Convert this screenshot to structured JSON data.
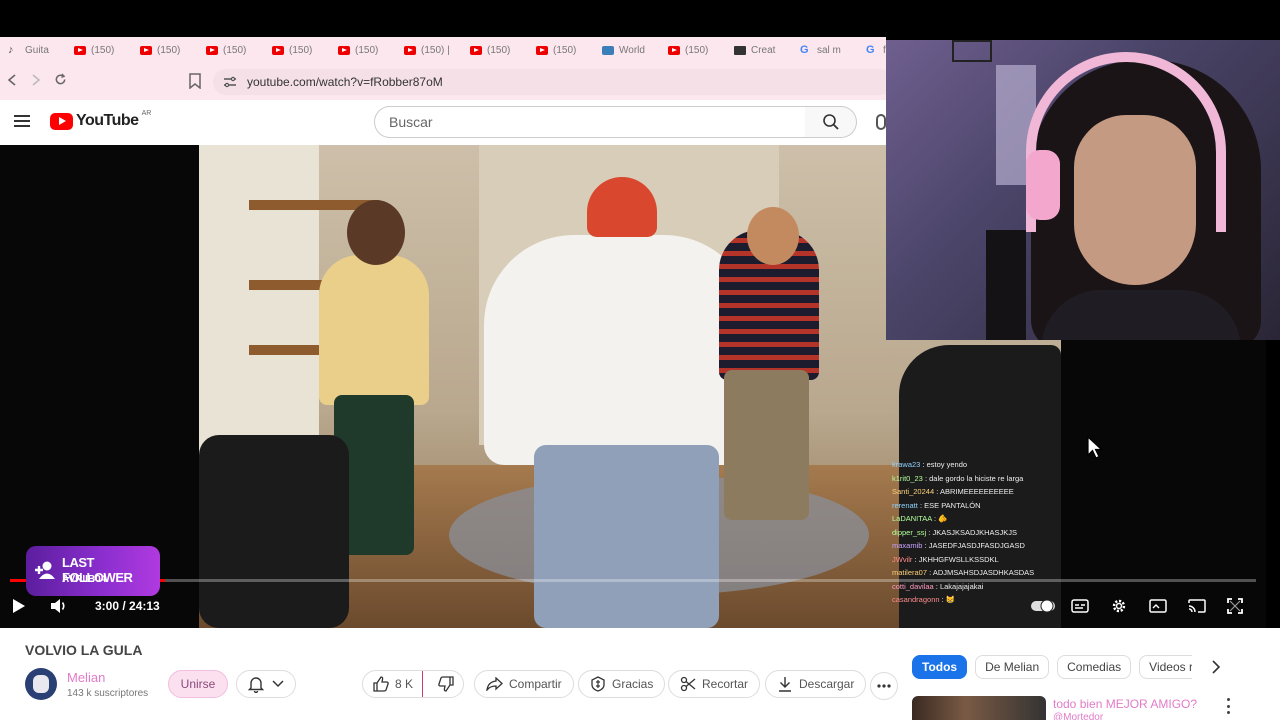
{
  "browser": {
    "tabs": [
      {
        "icon": "guitar-icon",
        "label": "Guita"
      },
      {
        "icon": "youtube-icon",
        "label": "(150)"
      },
      {
        "icon": "youtube-icon",
        "label": "(150)"
      },
      {
        "icon": "youtube-icon",
        "label": "(150)"
      },
      {
        "icon": "youtube-icon",
        "label": "(150)"
      },
      {
        "icon": "youtube-icon",
        "label": "(150)"
      },
      {
        "icon": "youtube-icon",
        "label": "(150) |"
      },
      {
        "icon": "youtube-icon",
        "label": "(150)"
      },
      {
        "icon": "youtube-icon",
        "label": "(150)"
      },
      {
        "icon": "world-icon",
        "label": "World"
      },
      {
        "icon": "youtube-icon",
        "label": "(150)"
      },
      {
        "icon": "creator-icon",
        "label": "Creat"
      },
      {
        "icon": "google-icon",
        "label": "sal m"
      },
      {
        "icon": "google-icon",
        "label": "fo"
      }
    ],
    "url": "youtube.com/watch?v=fRobber87oM"
  },
  "youtube": {
    "logo_text": "YouTube",
    "country_code": "AR",
    "search_placeholder": "Buscar"
  },
  "player": {
    "time": "3:00 / 24:13",
    "progress_fraction": 0.124,
    "chat": [
      {
        "user": "krawa23",
        "msg": "estoy yendo",
        "color": "u1"
      },
      {
        "user": "k1rit0_23",
        "msg": "dale gordo la hiciste re larga",
        "color": "u3"
      },
      {
        "user": "Santi_20244",
        "msg": "ABRIMEEEEEEEEEE",
        "color": "u4"
      },
      {
        "user": "rerenatt",
        "msg": "ESE PANTALÓN",
        "color": "u1"
      },
      {
        "user": "LaDANITAA",
        "msg": "🫵",
        "color": "u3"
      },
      {
        "user": "dipper_ssj",
        "msg": "JKASJKSADJKHASJKJS",
        "color": "u3"
      },
      {
        "user": "maxamib",
        "msg": "JASEDFJASDJFASDJGASD",
        "color": "u5"
      },
      {
        "user": "JWvilr",
        "msg": "JKHHGFWSLLKSSDKL",
        "color": "u6"
      },
      {
        "user": "matilera07",
        "msg": "ADJMSAHSDJASDHKASDAS",
        "color": "u4"
      },
      {
        "user": "cotti_davilaa",
        "msg": "Lakajajajakai",
        "color": "u2"
      },
      {
        "user": "casandragonn",
        "msg": "😸",
        "color": "u6"
      }
    ]
  },
  "overlay": {
    "title": "LAST FOLLOWER",
    "name": "AVRIIB04"
  },
  "video": {
    "title": "VOLVIO LA GULA",
    "channel": "Melian",
    "subscribers": "143 k suscriptores",
    "join_label": "Unirse",
    "likes": "8 K",
    "share_label": "Compartir",
    "thanks_label": "Gracias",
    "clip_label": "Recortar",
    "download_label": "Descargar"
  },
  "sidebar": {
    "chips": [
      "Todos",
      "De Melian",
      "Comedias",
      "Videos relac"
    ],
    "rec_title": "todo bien MEJOR AMIGO?",
    "rec_channel": "@Mortedor"
  },
  "colors": {
    "accent_pink": "#e27bc9",
    "chip_active": "#1a73e8",
    "progress": "#ff0000",
    "follower_bg": "#8e2fd1"
  }
}
